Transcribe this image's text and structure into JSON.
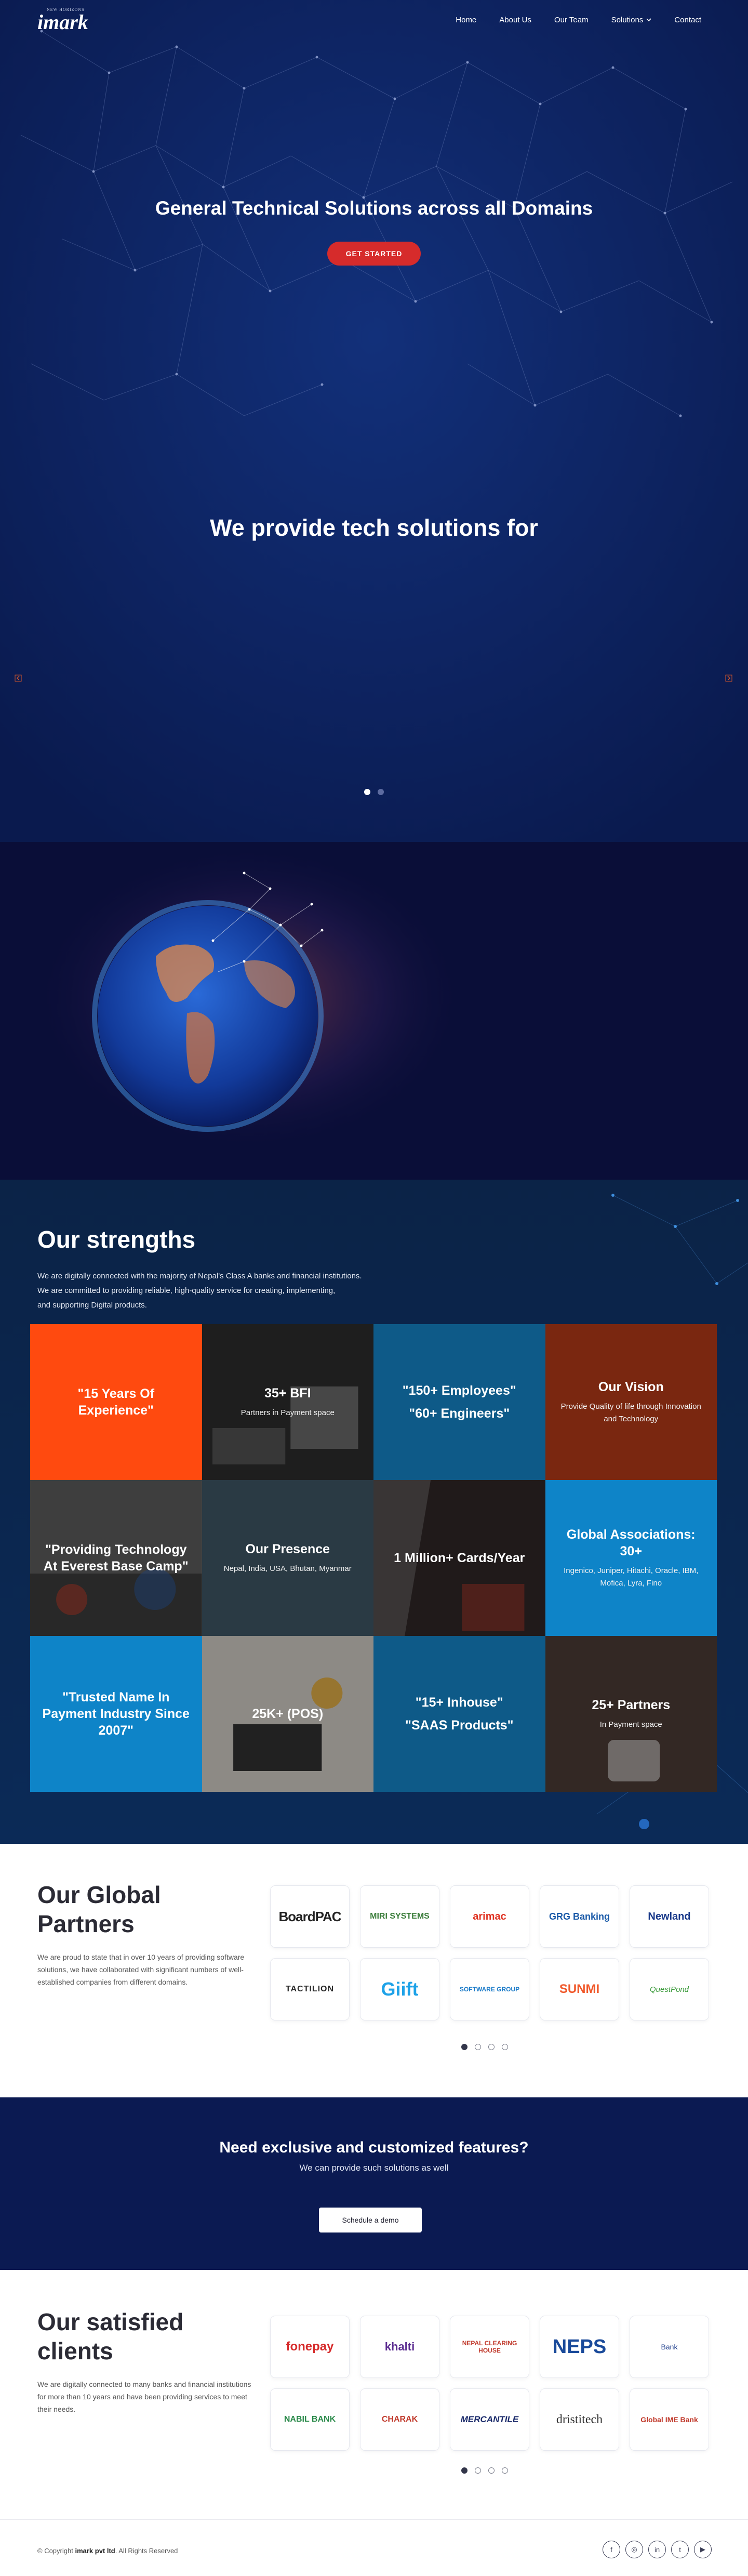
{
  "nav": {
    "logo_tag": "NEW HORIZONS",
    "logo_word": "imark",
    "items": [
      {
        "label": "Home",
        "has_dropdown": false
      },
      {
        "label": "About Us",
        "has_dropdown": false
      },
      {
        "label": "Our Team",
        "has_dropdown": false
      },
      {
        "label": "Solutions",
        "has_dropdown": true
      },
      {
        "label": "Contact",
        "has_dropdown": false
      }
    ]
  },
  "hero": {
    "title": "General Technical Solutions across all Domains",
    "button": "GET STARTED",
    "subtitle": "We provide tech solutions for",
    "slides_total": 2,
    "slide_active": 1
  },
  "strengths": {
    "title": "Our strengths",
    "text_lines": [
      "We are digitally connected with the majority of Nepal's Class A banks and financial institutions.",
      "We are committed to providing reliable, high-quality service for creating, implementing,",
      "and supporting Digital products."
    ],
    "cells": [
      {
        "heading": "\"15 Years Of Experience\"",
        "heading2": "",
        "text": "",
        "bg": "#ff4a0f"
      },
      {
        "heading": "35+ BFI",
        "heading2": "",
        "text": "Partners in Payment space",
        "bg": "#3b3b3b"
      },
      {
        "heading": "\"150+ Employees\"",
        "heading2": "\"60+ Engineers\"",
        "text": "",
        "bg": "#0e5a88"
      },
      {
        "heading": "Our Vision",
        "heading2": "",
        "text": "Provide Quality of life through Innovation and Technology",
        "bg": "#7a2710"
      },
      {
        "heading": "\"Providing Technology At Everest Base Camp\"",
        "heading2": "",
        "text": "",
        "bg": "#4a4a4a"
      },
      {
        "heading": "Our Presence",
        "heading2": "",
        "text": "Nepal, India, USA, Bhutan, Myanmar",
        "bg": "#2a3a44"
      },
      {
        "heading": "1 Million+ Cards/Year",
        "heading2": "",
        "text": "",
        "bg": "#3a2f2e"
      },
      {
        "heading": "Global Associations: 30+",
        "heading2": "",
        "text": "Ingenico, Juniper, Hitachi, Oracle, IBM, Mofica, Lyra, Fino",
        "bg": "#0e84c8"
      },
      {
        "heading": "\"Trusted Name In Payment Industry Since 2007\"",
        "heading2": "",
        "text": "",
        "bg": "#0e84c8"
      },
      {
        "heading": "25K+ (POS)",
        "heading2": "",
        "text": "",
        "bg": "#6b6b6b"
      },
      {
        "heading": "\"15+ Inhouse\"",
        "heading2": "\"SAAS Products\"",
        "text": "",
        "bg": "#0e5a88"
      },
      {
        "heading": "25+ Partners",
        "heading2": "",
        "text": "In Payment space",
        "bg": "#4a3a34"
      }
    ]
  },
  "partners": {
    "title_line1": "Our Global",
    "title_line2": "Partners",
    "text": "We are proud to state that in over 10 years of providing software solutions, we have collaborated with significant numbers of well-established companies from different domains.",
    "logos": [
      {
        "name": "BoardPAC",
        "icon": "boardpac-logo"
      },
      {
        "name": "MIRI SYSTEMS",
        "icon": "miri-systems-logo"
      },
      {
        "name": "arimac",
        "icon": "arimac-logo"
      },
      {
        "name": "GRG Banking",
        "icon": "grg-banking-logo"
      },
      {
        "name": "Newland",
        "icon": "newland-logo"
      },
      {
        "name": "TACTILION",
        "icon": "tactilion-logo"
      },
      {
        "name": "Giift",
        "icon": "giift-logo"
      },
      {
        "name": "SOFTWARE GROUP",
        "icon": "software-group-logo"
      },
      {
        "name": "SUNMI",
        "icon": "sunmi-logo"
      },
      {
        "name": "QuestPond",
        "icon": "questpond-logo"
      }
    ],
    "pages_total": 4,
    "page_active": 1
  },
  "cta": {
    "title": "Need exclusive and customized features?",
    "subtitle": "We can provide such solutions as well",
    "button": "Schedule a demo"
  },
  "clients": {
    "title_line1": "Our satisfied",
    "title_line2": "clients",
    "text": "We are digitally connected to many banks and financial institutions for more than 10 years and have been providing services to meet their needs.",
    "logos": [
      {
        "name": "fonepay",
        "icon": "fonepay-logo"
      },
      {
        "name": "khalti",
        "icon": "khalti-logo"
      },
      {
        "name": "NEPAL CLEARING HOUSE",
        "icon": "nepal-clearing-house-logo"
      },
      {
        "name": "NEPS",
        "icon": "neps-logo"
      },
      {
        "name": "Bank",
        "icon": "bank-logo"
      },
      {
        "name": "NABIL BANK",
        "icon": "nabil-bank-logo"
      },
      {
        "name": "CHARAK",
        "icon": "charak-logo"
      },
      {
        "name": "MERCANTILE",
        "icon": "mercantile-logo"
      },
      {
        "name": "dristitech",
        "icon": "dristitech-logo"
      },
      {
        "name": "Global IME Bank",
        "icon": "global-ime-bank-logo"
      }
    ],
    "pages_total": 4,
    "page_active": 1
  },
  "footer": {
    "copyright_prefix": "© Copyright ",
    "company": "imark pvt ltd",
    "copyright_suffix": ". All Rights Reserved",
    "social": [
      {
        "icon": "facebook-icon",
        "glyph": "f"
      },
      {
        "icon": "instagram-icon",
        "glyph": "◎"
      },
      {
        "icon": "linkedin-icon",
        "glyph": "in"
      },
      {
        "icon": "twitter-icon",
        "glyph": "t"
      },
      {
        "icon": "youtube-icon",
        "glyph": "▶"
      }
    ]
  },
  "colors": {
    "hero_bg": "#0b1d55",
    "accent_red": "#d62b2b",
    "cta_bg": "#0b1a52"
  }
}
